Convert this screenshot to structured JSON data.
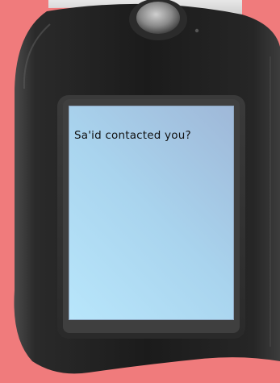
{
  "screen": {
    "message": "Sa'id contacted you?"
  },
  "colors": {
    "background": "#f07b7c",
    "phone_body": "#1e1e1e",
    "screen_light": "#b8e6fb",
    "screen_dark": "#9fb8d8",
    "message_text": "#111111"
  }
}
